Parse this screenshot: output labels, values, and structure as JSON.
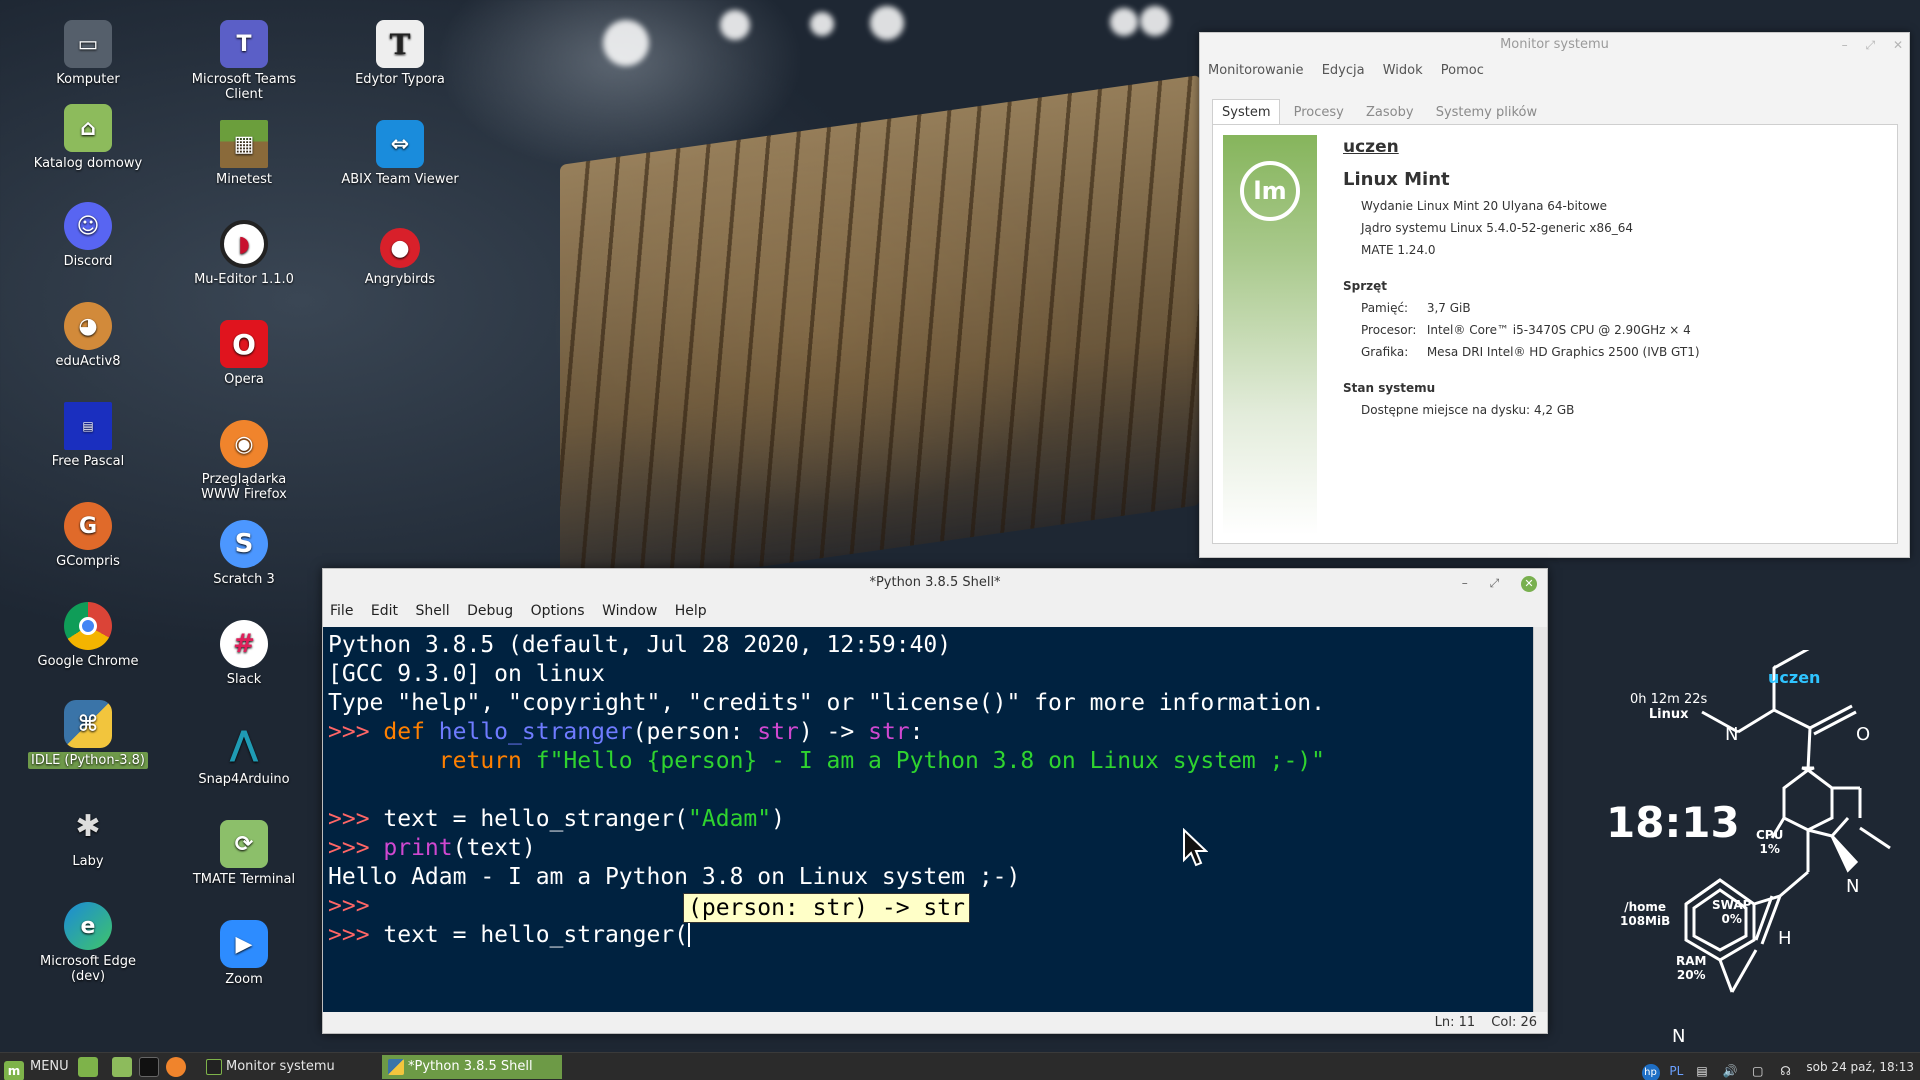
{
  "desktop": {
    "icons": [
      {
        "label": "Komputer",
        "icon": "computer-icon",
        "color": "#555f6b"
      },
      {
        "label": "Katalog domowy",
        "icon": "home-folder-icon",
        "color": "#8dbb5c"
      },
      {
        "label": "Discord",
        "icon": "discord-icon",
        "color": "#5865f2"
      },
      {
        "label": "eduActiv8",
        "icon": "eduactiv8-icon",
        "color": "#d28a3a"
      },
      {
        "label": "Free Pascal",
        "icon": "free-pascal-icon",
        "color": "#1a2fbf"
      },
      {
        "label": "GCompris",
        "icon": "gcompris-icon",
        "color": "#e06a2a"
      },
      {
        "label": "Google Chrome",
        "icon": "chrome-icon",
        "color": "#db4437"
      },
      {
        "label": "IDLE (Python-3.8)",
        "icon": "python-icon",
        "color": "#3a74a8"
      },
      {
        "label": "Laby",
        "icon": "laby-icon",
        "color": "#444444"
      },
      {
        "label": "Microsoft Edge (dev)",
        "icon": "edge-dev-icon",
        "color": "#1b8ad8"
      },
      {
        "label": "Microsoft Teams Client",
        "icon": "teams-icon",
        "color": "#5b5fc7"
      },
      {
        "label": "Minetest",
        "icon": "minetest-icon",
        "color": "#6b9e3c"
      },
      {
        "label": "Mu-Editor 1.1.0",
        "icon": "mu-editor-icon",
        "color": "#c8102e"
      },
      {
        "label": "Opera",
        "icon": "opera-icon",
        "color": "#e0141e"
      },
      {
        "label": "Przeglądarka WWW Firefox",
        "icon": "firefox-icon",
        "color": "#f0842c"
      },
      {
        "label": "Scratch 3",
        "icon": "scratch-icon",
        "color": "#4c97ff"
      },
      {
        "label": "Slack",
        "icon": "slack-icon",
        "color": "#ffffff"
      },
      {
        "label": "Snap4Arduino",
        "icon": "snap4arduino-icon",
        "color": "#1f9bb4"
      },
      {
        "label": "TMATE Terminal",
        "icon": "tmate-icon",
        "color": "#8cbf6a"
      },
      {
        "label": "Zoom",
        "icon": "zoom-icon",
        "color": "#2d8cff"
      },
      {
        "label": "Edytor Typora",
        "icon": "typora-icon",
        "color": "#eeeeee"
      },
      {
        "label": "ABIX Team Viewer",
        "icon": "teamviewer-icon",
        "color": "#1a8cdc"
      },
      {
        "label": "Angrybirds",
        "icon": "angrybirds-icon",
        "color": "#d8202a"
      }
    ]
  },
  "sysmon": {
    "title": "Monitor systemu",
    "menu": [
      "Monitorowanie",
      "Edycja",
      "Widok",
      "Pomoc"
    ],
    "tabs": [
      "System",
      "Procesy",
      "Zasoby",
      "Systemy plików"
    ],
    "active_tab": "System",
    "username": "uczen",
    "os": "Linux Mint",
    "release": "Wydanie Linux Mint 20 Ulyana 64-bitowe",
    "kernel": "Jądro systemu Linux 5.4.0-52-generic x86_64",
    "mate": "MATE 1.24.0",
    "hardware_header": "Sprzęt",
    "memory_label": "Pamięć:",
    "memory_value": "3,7 GiB",
    "cpu_label": "Procesor:",
    "cpu_value": "Intel® Core™ i5-3470S CPU @ 2.90GHz × 4",
    "gpu_label": "Grafika:",
    "gpu_value": "Mesa DRI Intel® HD Graphics 2500 (IVB GT1)",
    "status_header": "Stan systemu",
    "disk_label": "Dostępne miejsce na dysku:",
    "disk_value": "4,2 GB"
  },
  "idle": {
    "title": "*Python 3.8.5 Shell*",
    "menu": [
      "File",
      "Edit",
      "Shell",
      "Debug",
      "Options",
      "Window",
      "Help"
    ],
    "line1": "Python 3.8.5 (default, Jul 28 2020, 12:59:40)",
    "line2": "[GCC 9.3.0] on linux",
    "line3": "Type \"help\", \"copyright\", \"credits\" or \"license()\" for more information.",
    "prompt": ">>> ",
    "l4_def": "def",
    "l4_name": "hello_stranger",
    "l4_p1": "(person: ",
    "l4_str1": "str",
    "l4_p2": ") -> ",
    "l4_str2": "str",
    "l4_p3": ":",
    "l5_indent": "        ",
    "l5_return": "return",
    "l5_fstring": " f\"Hello {person} - I am a Python 3.8 on Linux system ;-)\"",
    "l7_a": "text = hello_stranger(",
    "l7_str": "\"Adam\"",
    "l7_b": ")",
    "l8_print": "print",
    "l8_b": "(text)",
    "l9_output": "Hello Adam - I am a Python 3.8 on Linux system ;-)",
    "l11_a": "text = hello_stranger(",
    "calltip": "(person: str) -> str",
    "status_ln": "Ln: 11",
    "status_col": "Col: 26"
  },
  "conky": {
    "user": "uczen",
    "uptime": "0h 12m 22s",
    "os": "Linux",
    "time": "18:13",
    "cpu_label": "CPU",
    "cpu_value": "1%",
    "swap_label": "SWAP",
    "swap_value": "0%",
    "home_label": "/home",
    "home_value": "108MiB",
    "ram_label": "RAM",
    "ram_value": "20%",
    "atom_o": "O",
    "atom_n1": "N",
    "atom_n2": "N",
    "atom_n3": "N",
    "atom_h": "H"
  },
  "taskbar": {
    "menu_label": "MENU",
    "tasks": [
      "Monitor systemu",
      "*Python 3.8.5 Shell"
    ],
    "active_task": "*Python 3.8.5 Shell",
    "keyboard_layout": "PL",
    "clock": "sob 24 paź, 18:13"
  },
  "colors": {
    "mint_green": "#7eb34a",
    "idle_bg": "#002240",
    "prompt": "#ff6666",
    "keyword": "#ff8000",
    "string": "#2fd42f",
    "conky_user": "#2fc4ff"
  }
}
